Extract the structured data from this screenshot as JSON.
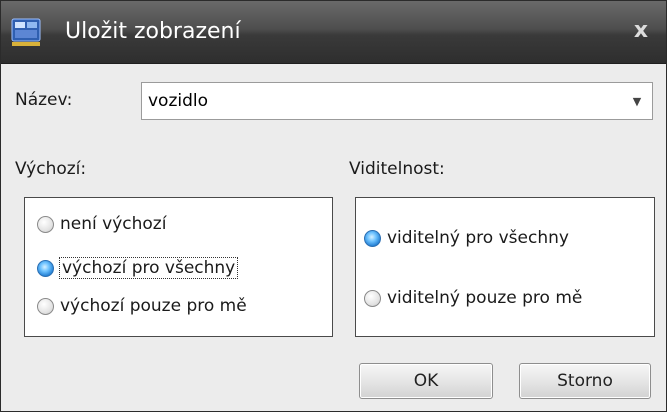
{
  "window": {
    "title": "Uložit zobrazení",
    "app_icon": "save-view-icon",
    "close_glyph": "x"
  },
  "name_field": {
    "label": "Název:",
    "value": "vozidlo",
    "dropdown_icon": "chevron-down-icon"
  },
  "default_group": {
    "label": "Výchozí:",
    "options": [
      {
        "label": "není výchozí",
        "checked": false
      },
      {
        "label": "výchozí pro všechny",
        "checked": true
      },
      {
        "label": "výchozí pouze pro mě",
        "checked": false
      }
    ]
  },
  "visibility_group": {
    "label": "Viditelnost:",
    "options": [
      {
        "label": "viditelný pro všechny",
        "checked": true
      },
      {
        "label": "viditelný pouze pro mě",
        "checked": false
      }
    ]
  },
  "buttons": {
    "ok": "OK",
    "cancel": "Storno"
  },
  "colors": {
    "titlebar": "#3a3a3a",
    "radio_selected": "#2a86d8",
    "dialog_bg": "#ececec"
  }
}
